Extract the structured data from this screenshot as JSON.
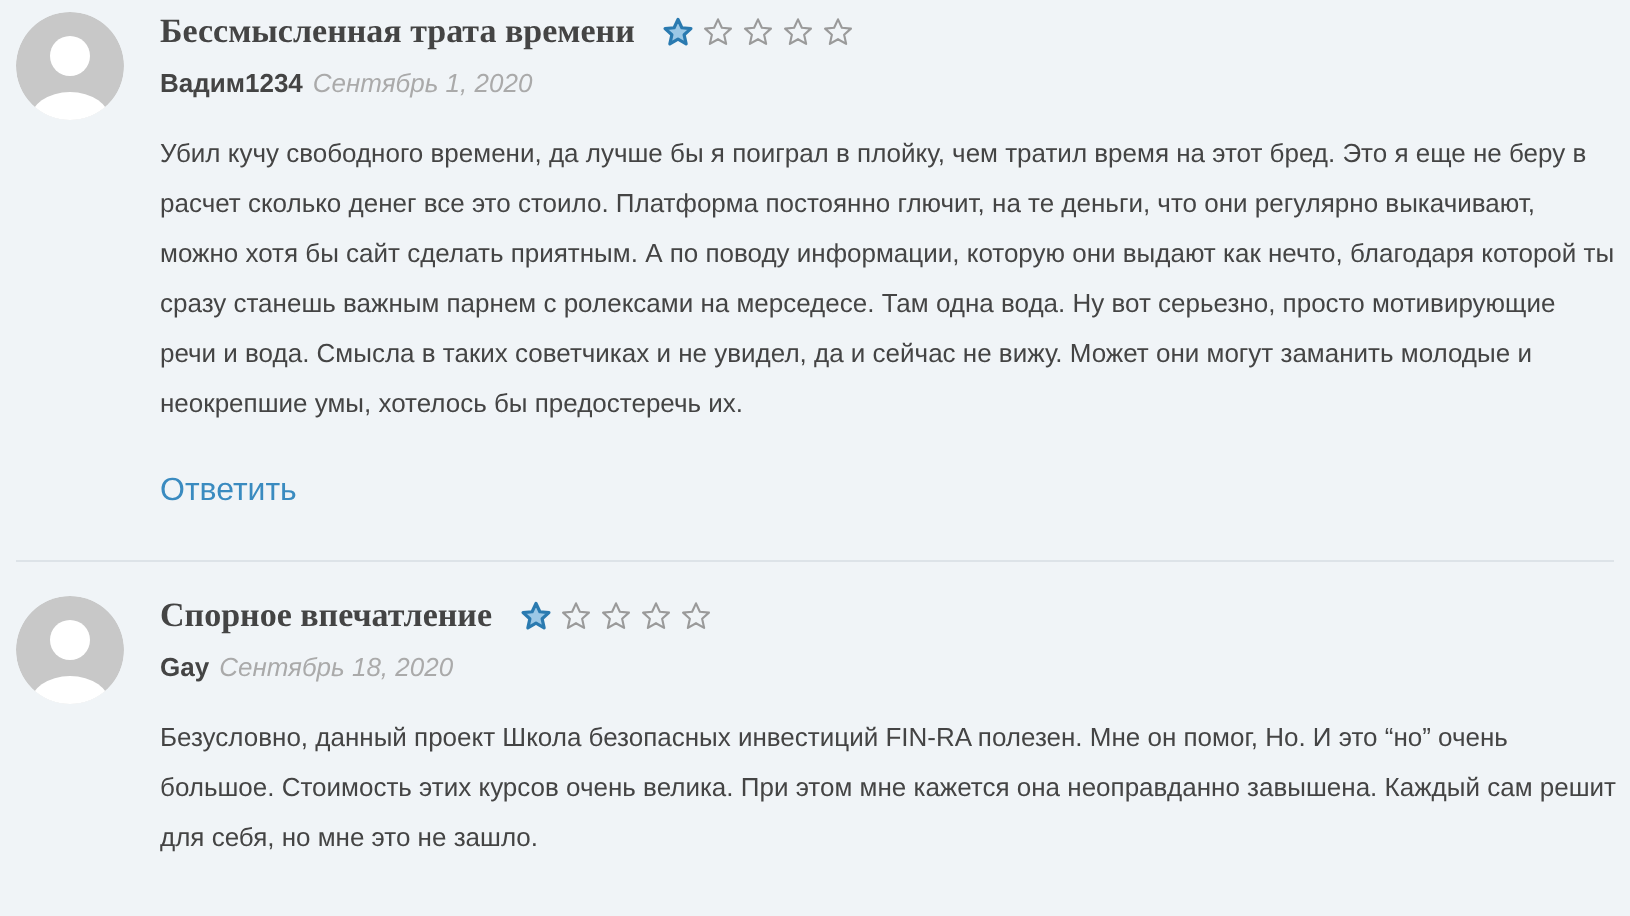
{
  "reviews": [
    {
      "title": "Бессмысленная трата времени",
      "stars": 1,
      "author": "Вадим1234",
      "date": "Сентябрь 1, 2020",
      "text": "Убил кучу свободного времени, да лучше бы я поиграл в плойку, чем тратил время на этот бред. Это я еще не беру в расчет сколько денег все это стоило. Платформа постоянно глючит, на те деньги, что они регулярно выкачивают, можно хотя бы сайт сделать приятным. А по поводу информации, которую они выдают как нечто, благодаря которой ты сразу станешь важным парнем с ролексами на мерседесе. Там одна вода. Ну вот серьезно, просто мотивирующие речи и вода. Смысла в таких советчиках и не увидел, да и сейчас не вижу. Может они могут заманить молодые и неокрепшие умы, хотелось бы предостеречь их.",
      "reply": "Ответить"
    },
    {
      "title": "Спорное впечатление",
      "stars": 1,
      "author": "Gay",
      "date": "Сентябрь 18, 2020",
      "text": "Безусловно, данный проект Школа безопасных инвестиций FIN-RA полезен. Мне он помог, Но. И это “но” очень большое. Стоимость этих курсов очень велика. При этом мне кажется она неоправданно завышена. Каждый сам решит для себя, но мне это не зашло."
    }
  ]
}
